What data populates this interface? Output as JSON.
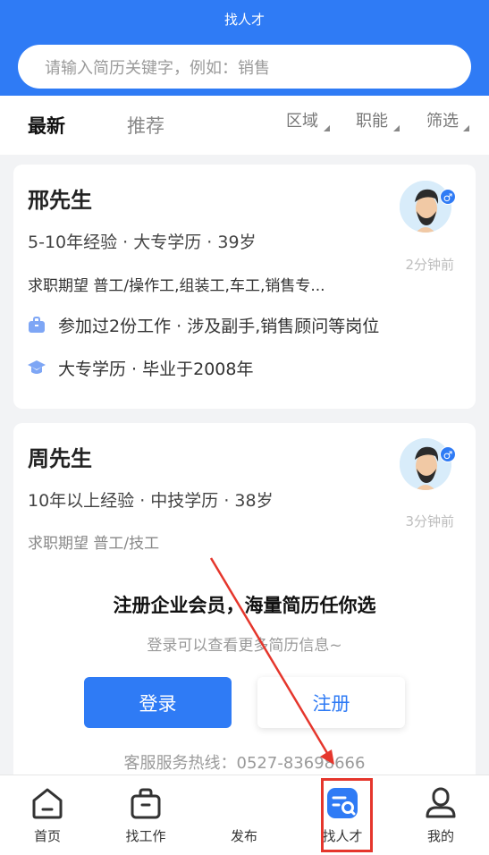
{
  "header": {
    "title": "找人才",
    "search_placeholder": "请输入简历关键字，例如：销售"
  },
  "tabs": {
    "latest": "最新",
    "recommend": "推荐",
    "filters": [
      "区域",
      "职能",
      "筛选"
    ]
  },
  "cards": [
    {
      "name": "邢先生",
      "summary": "5-10年经验 · 大专学历 · 39岁",
      "expectation": "求职期望 普工/操作工,组装工,车工,销售专...",
      "time": "2分钟前",
      "gender": "♂",
      "work": "参加过2份工作 · 涉及副手,销售顾问等岗位",
      "education": "大专学历 · 毕业于2008年"
    },
    {
      "name": "周先生",
      "summary": "10年以上经验 · 中技学历 · 38岁",
      "expectation": "求职期望 普工/技工",
      "time": "3分钟前",
      "gender": "♂"
    }
  ],
  "promo": {
    "title": "注册企业会员，海量简历任你选",
    "subtitle": "登录可以查看更多简历信息~",
    "login": "登录",
    "register": "注册",
    "hotline": "客服服务热线：0527-83698666"
  },
  "tabbar": {
    "items": [
      "首页",
      "找工作",
      "发布",
      "找人才",
      "我的"
    ]
  },
  "colors": {
    "primary": "#2f7bf5",
    "highlight": "#e5362c"
  }
}
